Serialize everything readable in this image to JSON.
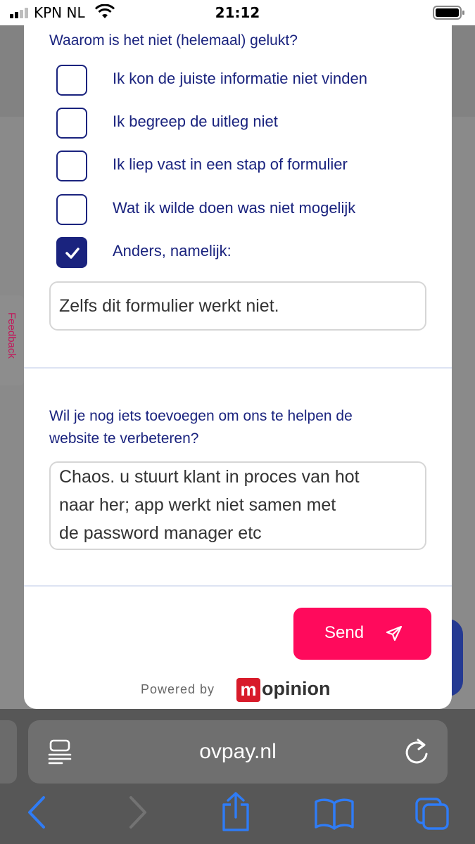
{
  "status_bar": {
    "carrier": "KPN NL",
    "time": "21:12"
  },
  "feedback_tab": {
    "label": "Feedback"
  },
  "form": {
    "question1": "Waarom is het niet (helemaal) gelukt?",
    "options": [
      {
        "label": "Ik kon de juiste informatie niet vinden",
        "checked": false
      },
      {
        "label": "Ik begreep de uitleg niet",
        "checked": false
      },
      {
        "label": "Ik liep vast in een stap of formulier",
        "checked": false
      },
      {
        "label": "Wat ik wilde doen was niet mogelijk",
        "checked": false
      },
      {
        "label": "Anders, namelijk:",
        "checked": true
      }
    ],
    "other_value": "Zelfs dit formulier werkt niet.",
    "question2_line1": "Wil je nog iets toevoegen om ons te helpen de",
    "question2_line2": "website te verbeteren?",
    "comment_line1": "Chaos. u stuurt klant in proces van hot",
    "comment_line2": "naar her; app werkt niet samen met",
    "comment_line3": "de password manager etc",
    "send_label": "Send",
    "powered_by": "Powered by",
    "brand_m": "m",
    "brand_rest": "opinion"
  },
  "browser": {
    "url": "ovpay.nl"
  },
  "icons": {
    "checkmark": "checkmark-icon",
    "send": "paper-plane-icon",
    "reader": "reader-mode-icon",
    "reload": "reload-icon",
    "back": "chevron-left-icon",
    "forward": "chevron-right-icon",
    "share": "share-icon",
    "bookmarks": "book-icon",
    "tabs": "tabs-icon"
  },
  "colors": {
    "primary_text": "#1a237e",
    "send_button": "#ff0a5c",
    "brand_red": "#d81b2a",
    "toolbar_blue": "#2f7cf6"
  }
}
